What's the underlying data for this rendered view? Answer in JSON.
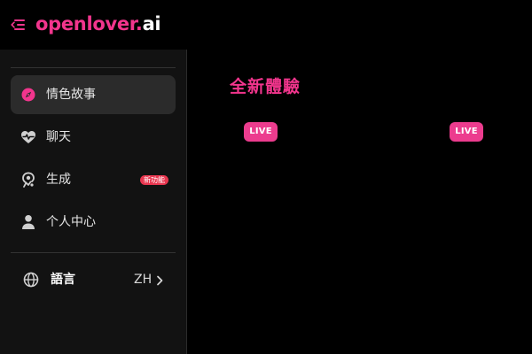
{
  "header": {
    "brand_name": "openlover",
    "brand_dot": ".",
    "brand_tld": "ai",
    "menu_icon": "menu-collapse-icon"
  },
  "sidebar": {
    "items": [
      {
        "label": "情色故事",
        "icon": "compass-icon",
        "active": true
      },
      {
        "label": "聊天",
        "icon": "heart-pulse-icon",
        "active": false
      },
      {
        "label": "生成",
        "icon": "generate-icon",
        "active": false,
        "badge": "新功能"
      },
      {
        "label": "个人中心",
        "icon": "user-icon",
        "active": false
      }
    ],
    "language": {
      "label": "語言",
      "value": "ZH",
      "icon": "globe-icon"
    }
  },
  "main": {
    "section_title": "全新體驗",
    "cards": [
      {
        "badge": "LIVE"
      },
      {
        "badge": "LIVE"
      }
    ]
  },
  "colors": {
    "accent": "#f2358d",
    "sidebar_bg": "#121212",
    "active_bg": "#2b2b2b",
    "badge_red": "#e8364f",
    "background": "#000000"
  }
}
